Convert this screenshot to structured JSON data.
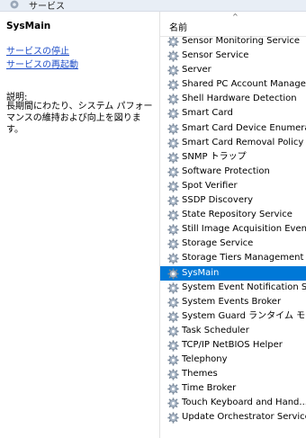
{
  "window": {
    "title": "サービス"
  },
  "left": {
    "service_name": "SysMain",
    "links": [
      "サービスの停止",
      "サービスの再起動"
    ],
    "description_label": "説明:",
    "description_text": "長期間にわたり、システム パフォーマンスの維持および向上を図ります。"
  },
  "list": {
    "column_header": "名前",
    "sort_indicator": "^",
    "selected_index": 16,
    "accent_color": "#0078d7",
    "icon": "gear-icon",
    "items": [
      "Sensor Monitoring Service",
      "Sensor Service",
      "Server",
      "Shared PC Account Manager",
      "Shell Hardware Detection",
      "Smart Card",
      "Smart Card Device Enumera...",
      "Smart Card Removal Policy",
      "SNMP トラップ",
      "Software Protection",
      "Spot Verifier",
      "SSDP Discovery",
      "State Repository Service",
      "Still Image Acquisition Events",
      "Storage Service",
      "Storage Tiers Management",
      "SysMain",
      "System Event Notification S...",
      "System Events Broker",
      "System Guard ランタイム モニ...",
      "Task Scheduler",
      "TCP/IP NetBIOS Helper",
      "Telephony",
      "Themes",
      "Time Broker",
      "Touch Keyboard and Hand...",
      "Update Orchestrator Service"
    ]
  }
}
